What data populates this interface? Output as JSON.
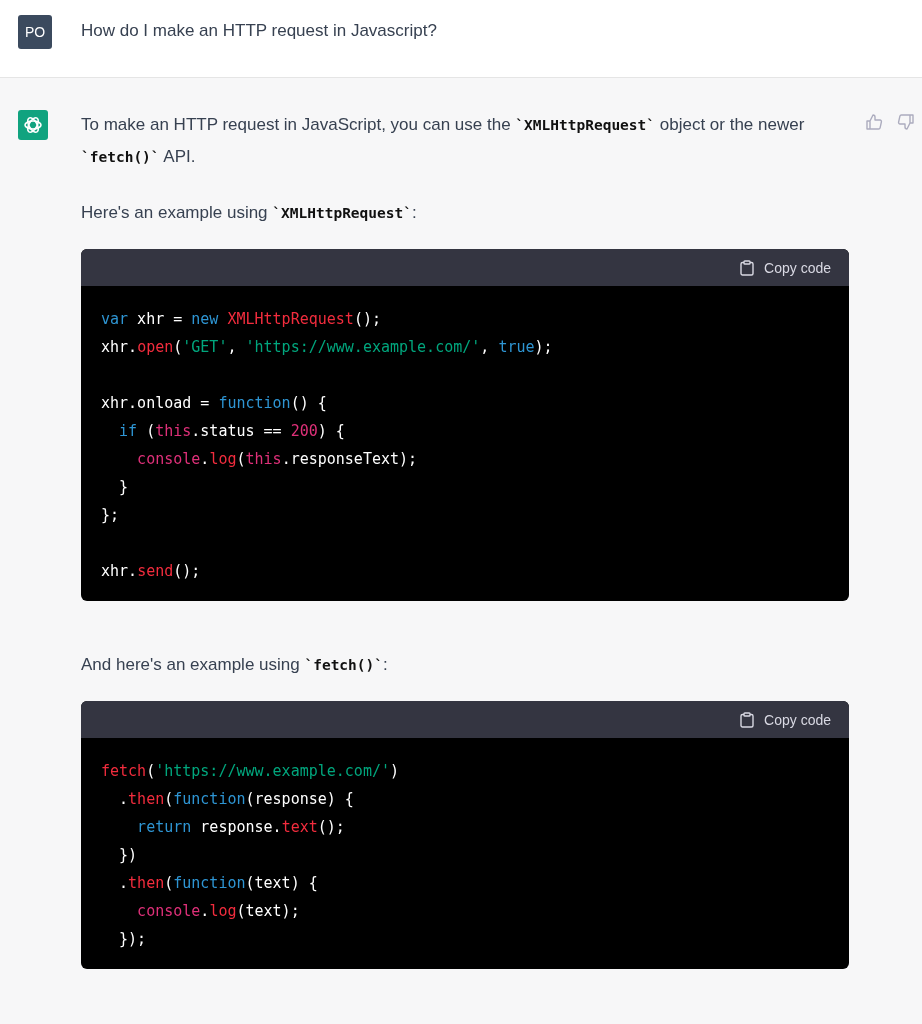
{
  "user_message": {
    "avatar": "PO",
    "text": "How do I make an HTTP request in Javascript?"
  },
  "assistant_message": {
    "blocks": [
      {
        "kind": "paragraph",
        "segments": [
          {
            "kind": "text",
            "text": "To make an HTTP request in JavaScript, you can use the "
          },
          {
            "kind": "code",
            "text": "`XMLHttpRequest`"
          },
          {
            "kind": "text",
            "text": " object or the newer "
          },
          {
            "kind": "code",
            "text": "`fetch()`"
          },
          {
            "kind": "text",
            "text": " API."
          }
        ]
      },
      {
        "kind": "paragraph",
        "segments": [
          {
            "kind": "text",
            "text": "Here's an example using "
          },
          {
            "kind": "code",
            "text": "`XMLHttpRequest`"
          },
          {
            "kind": "text",
            "text": ":"
          }
        ]
      },
      {
        "kind": "code_block",
        "copy_label": "Copy code",
        "lines": [
          {
            "kind": "code",
            "tokens": [
              {
                "kind": "keyword",
                "text": "var"
              },
              {
                "kind": "plain",
                "text": " xhr = "
              },
              {
                "kind": "keyword",
                "text": "new "
              },
              {
                "kind": "call",
                "text": "XMLHttpRequest"
              },
              {
                "kind": "plain",
                "text": "();"
              }
            ]
          },
          {
            "kind": "code",
            "tokens": [
              {
                "kind": "plain",
                "text": "xhr."
              },
              {
                "kind": "call",
                "text": "open"
              },
              {
                "kind": "plain",
                "text": "("
              },
              {
                "kind": "string",
                "text": "'GET'"
              },
              {
                "kind": "plain",
                "text": ", "
              },
              {
                "kind": "string",
                "text": "'https://www.example.com/'"
              },
              {
                "kind": "plain",
                "text": ", "
              },
              {
                "kind": "keyword",
                "text": "true"
              },
              {
                "kind": "plain",
                "text": ");"
              }
            ]
          },
          {
            "kind": "blank"
          },
          {
            "kind": "code",
            "tokens": [
              {
                "kind": "plain",
                "text": "xhr.onload = "
              },
              {
                "kind": "keyword",
                "text": "function"
              },
              {
                "kind": "plain",
                "text": "() {"
              }
            ]
          },
          {
            "kind": "code",
            "tokens": [
              {
                "kind": "keyword",
                "text": "  if"
              },
              {
                "kind": "plain",
                "text": " ("
              },
              {
                "kind": "builtin",
                "text": "this"
              },
              {
                "kind": "plain",
                "text": ".status == "
              },
              {
                "kind": "builtin",
                "text": "200"
              },
              {
                "kind": "plain",
                "text": ") {"
              }
            ]
          },
          {
            "kind": "code",
            "tokens": [
              {
                "kind": "builtin",
                "text": "    console"
              },
              {
                "kind": "plain",
                "text": "."
              },
              {
                "kind": "call",
                "text": "log"
              },
              {
                "kind": "plain",
                "text": "("
              },
              {
                "kind": "builtin",
                "text": "this"
              },
              {
                "kind": "plain",
                "text": ".responseText);"
              }
            ]
          },
          {
            "kind": "code",
            "tokens": [
              {
                "kind": "plain",
                "text": "  }"
              }
            ]
          },
          {
            "kind": "code",
            "tokens": [
              {
                "kind": "plain",
                "text": "};"
              }
            ]
          },
          {
            "kind": "blank"
          },
          {
            "kind": "code",
            "tokens": [
              {
                "kind": "plain",
                "text": "xhr."
              },
              {
                "kind": "call",
                "text": "send"
              },
              {
                "kind": "plain",
                "text": "();"
              }
            ]
          }
        ]
      },
      {
        "kind": "paragraph",
        "segments": [
          {
            "kind": "text",
            "text": "And here's an example using "
          },
          {
            "kind": "code",
            "text": "`fetch()`"
          },
          {
            "kind": "text",
            "text": ":"
          }
        ]
      },
      {
        "kind": "code_block",
        "copy_label": "Copy code",
        "lines": [
          {
            "kind": "code",
            "tokens": [
              {
                "kind": "call",
                "text": "fetch"
              },
              {
                "kind": "plain",
                "text": "("
              },
              {
                "kind": "string",
                "text": "'https://www.example.com/'"
              },
              {
                "kind": "plain",
                "text": ")"
              }
            ]
          },
          {
            "kind": "code",
            "tokens": [
              {
                "kind": "plain",
                "text": "  ."
              },
              {
                "kind": "call",
                "text": "then"
              },
              {
                "kind": "plain",
                "text": "("
              },
              {
                "kind": "keyword",
                "text": "function"
              },
              {
                "kind": "plain",
                "text": "(response) {"
              }
            ]
          },
          {
            "kind": "code",
            "tokens": [
              {
                "kind": "keyword",
                "text": "    return"
              },
              {
                "kind": "plain",
                "text": " response."
              },
              {
                "kind": "call",
                "text": "text"
              },
              {
                "kind": "plain",
                "text": "();"
              }
            ]
          },
          {
            "kind": "code",
            "tokens": [
              {
                "kind": "plain",
                "text": "  })"
              }
            ]
          },
          {
            "kind": "code",
            "tokens": [
              {
                "kind": "plain",
                "text": "  ."
              },
              {
                "kind": "call",
                "text": "then"
              },
              {
                "kind": "plain",
                "text": "("
              },
              {
                "kind": "keyword",
                "text": "function"
              },
              {
                "kind": "plain",
                "text": "(text) {"
              }
            ]
          },
          {
            "kind": "code",
            "tokens": [
              {
                "kind": "builtin",
                "text": "    console"
              },
              {
                "kind": "plain",
                "text": "."
              },
              {
                "kind": "call",
                "text": "log"
              },
              {
                "kind": "plain",
                "text": "(text);"
              }
            ]
          },
          {
            "kind": "code",
            "tokens": [
              {
                "kind": "plain",
                "text": "  });"
              }
            ]
          }
        ]
      }
    ]
  }
}
